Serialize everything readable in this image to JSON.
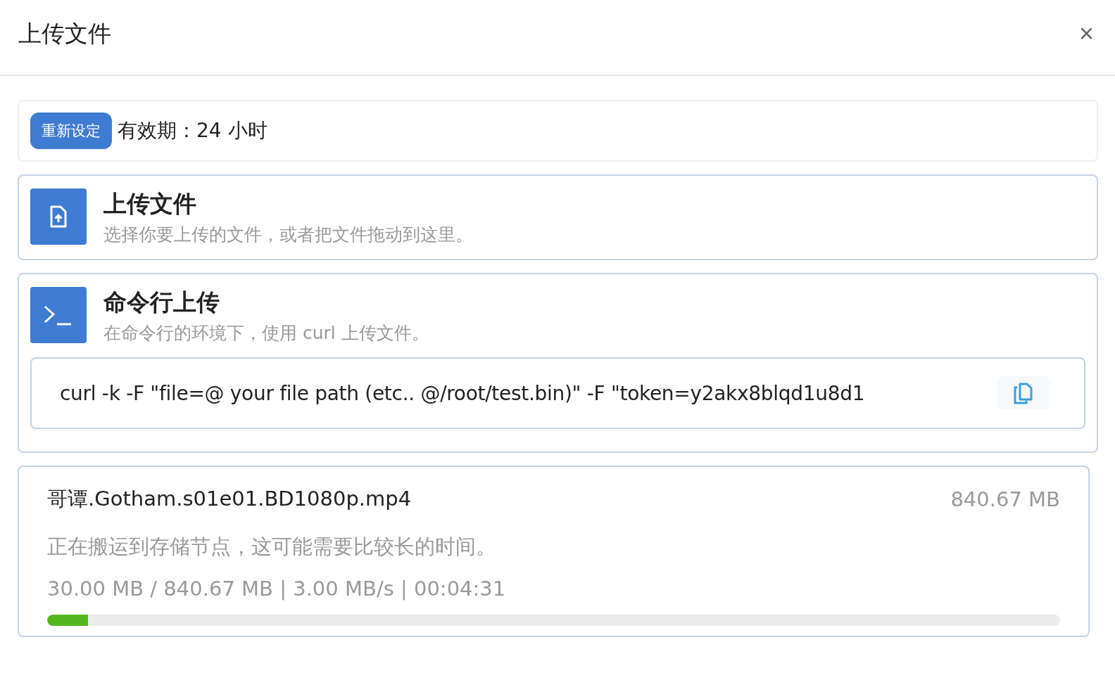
{
  "dialog": {
    "title": "上传文件",
    "close_label": "×"
  },
  "expiry": {
    "button": "重新设定",
    "label": "有效期：",
    "value": "24 小时"
  },
  "options": [
    {
      "kind": "file",
      "title": "上传文件",
      "description": "选择你要上传的文件，或者把文件拖动到这里。"
    },
    {
      "kind": "cli",
      "title": "命令行上传",
      "description": "在命令行的环境下，使用 curl 上传文件。",
      "command": "curl -k -F \"file=@ your file path (etc.. @/root/test.bin)\" -F \"token=y2akx8blqd1u8d1"
    }
  ],
  "uploads": [
    {
      "name": "哥谭.Gotham.s01e01.BD1080p.mp4",
      "size": "840.67 MB",
      "status": "正在搬运到存储节点，这可能需要比较长的时间。",
      "progress": "30.00 MB / 840.67 MB | 3.00 MB/s | 00:04:31",
      "level": 0.04
    }
  ]
}
